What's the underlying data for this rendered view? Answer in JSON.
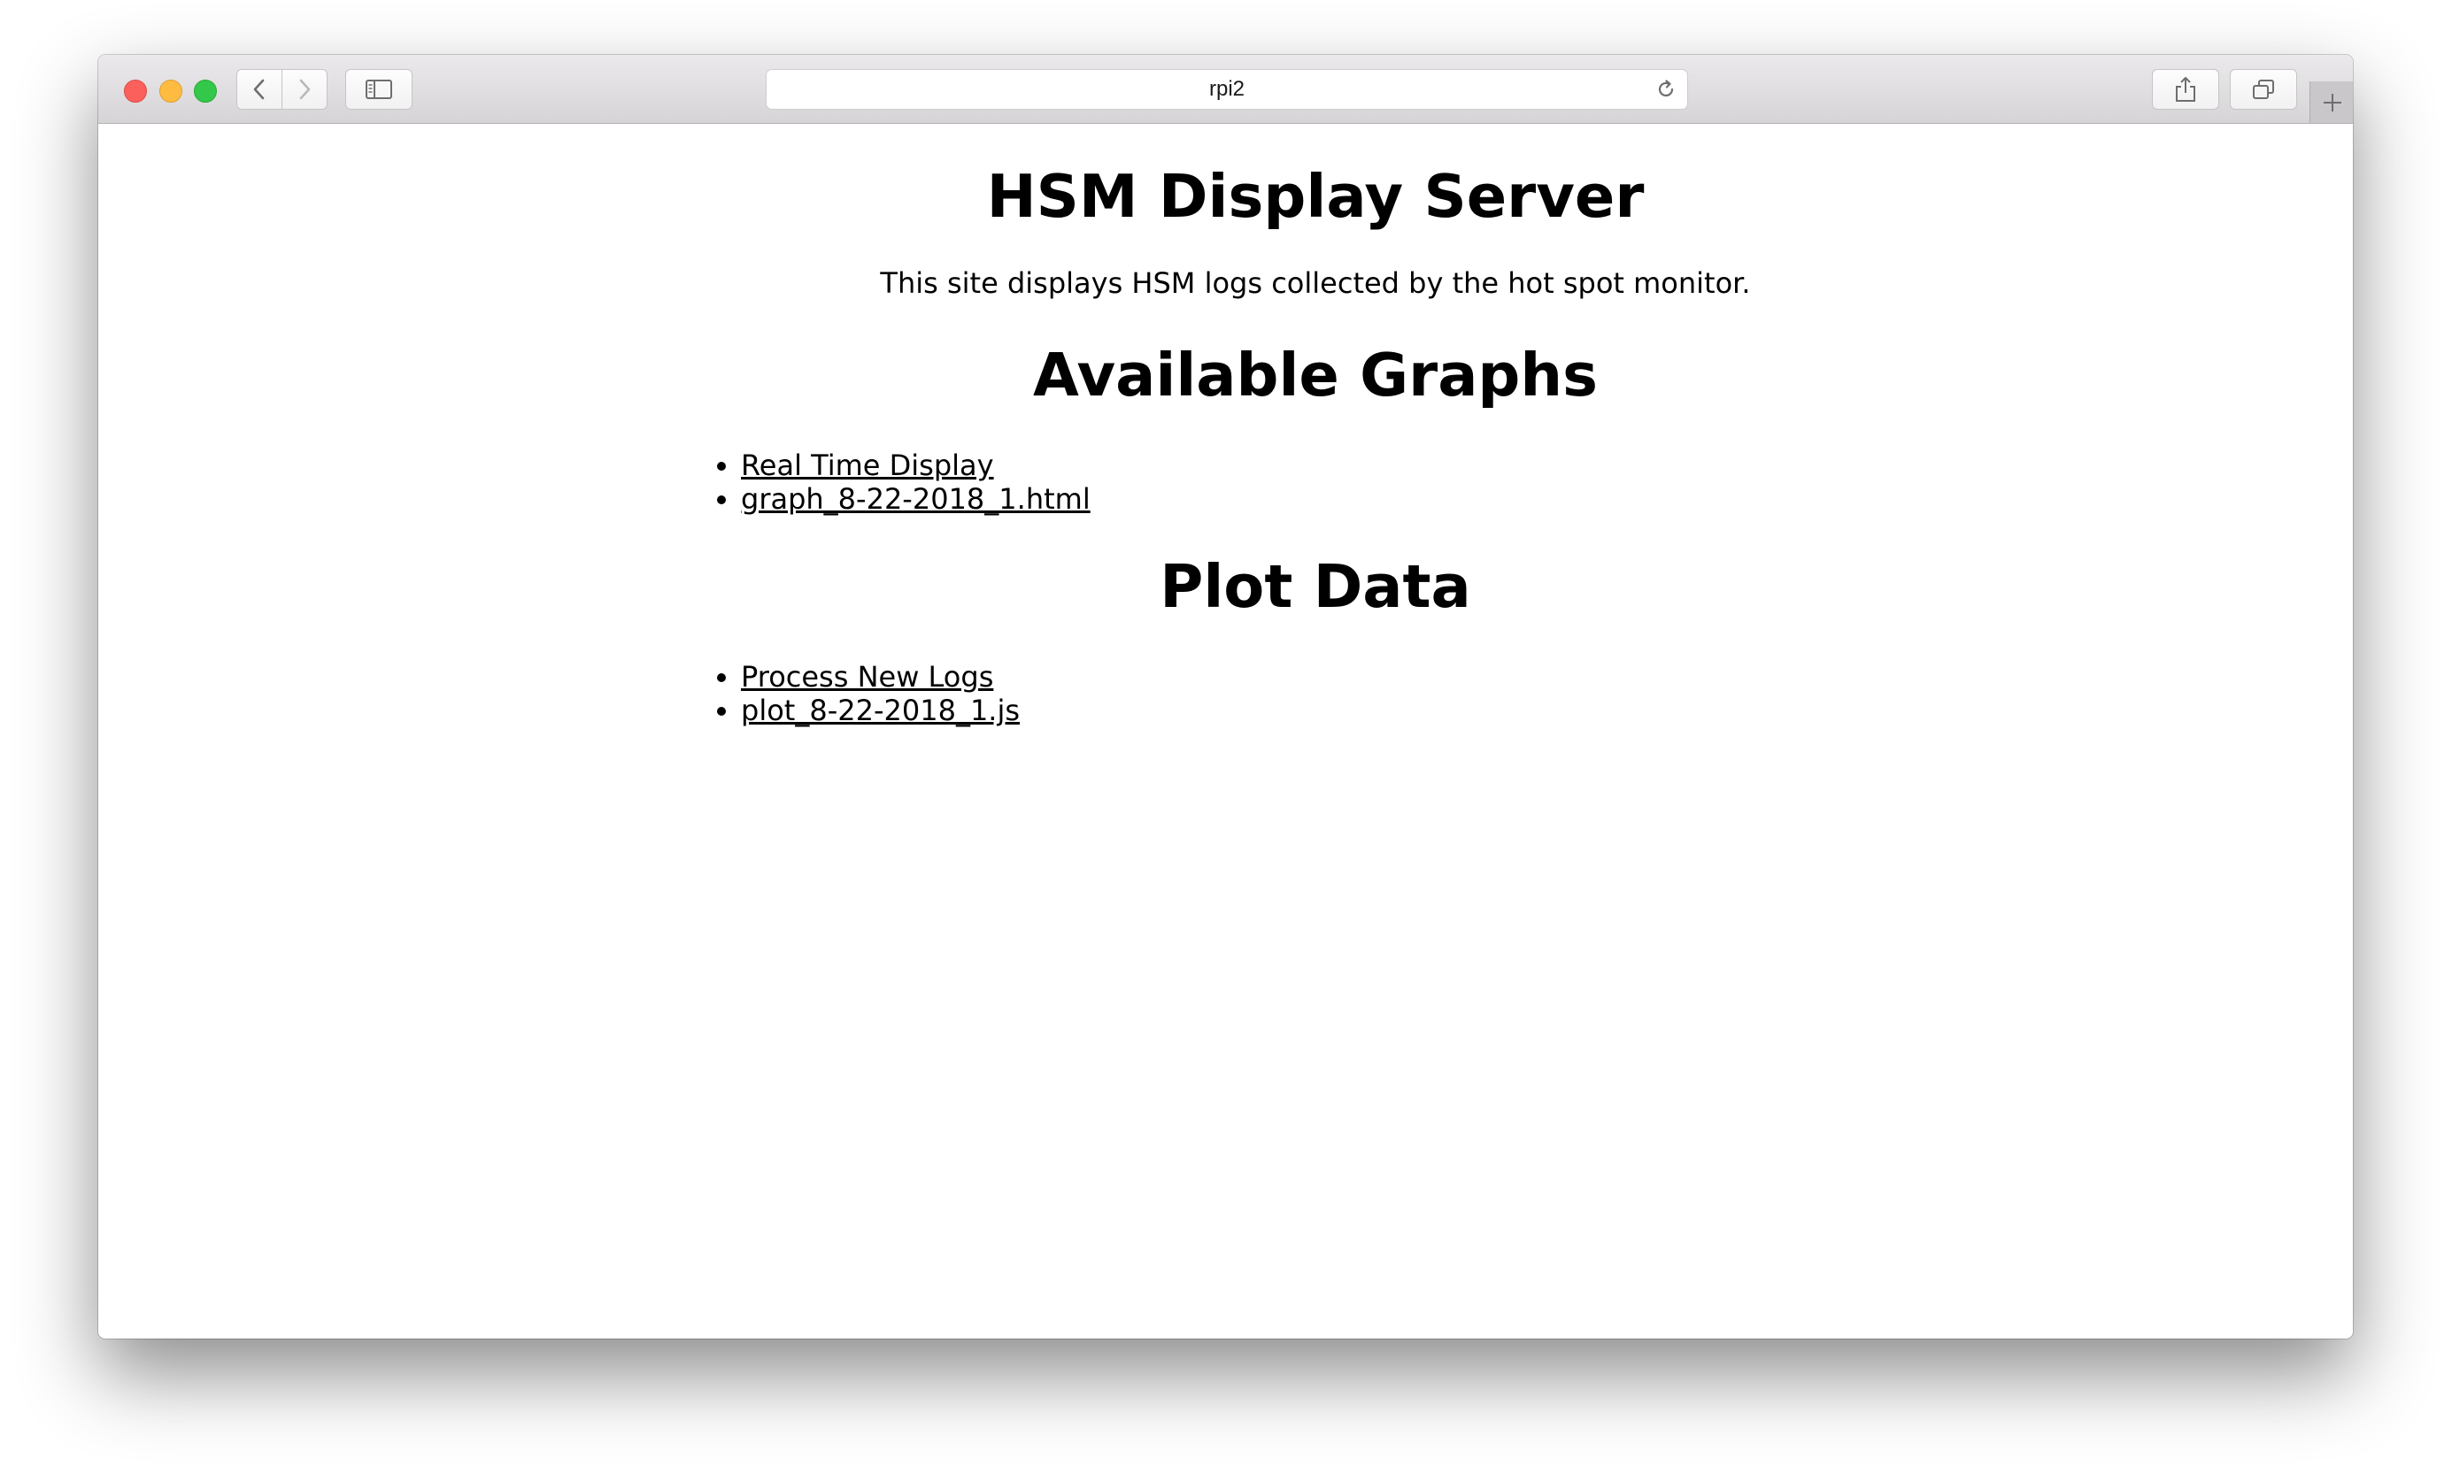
{
  "browser": {
    "address": "rpi2"
  },
  "page": {
    "title": "HSM Display Server",
    "subtitle": "This site displays HSM logs collected by the hot spot monitor.",
    "graphs_heading": "Available Graphs",
    "graphs": [
      {
        "label": "Real Time Display"
      },
      {
        "label": "graph_8-22-2018_1.html"
      }
    ],
    "plot_heading": "Plot Data",
    "plot_items": [
      {
        "label": "Process New Logs"
      },
      {
        "label": "plot_8-22-2018_1.js"
      }
    ]
  }
}
